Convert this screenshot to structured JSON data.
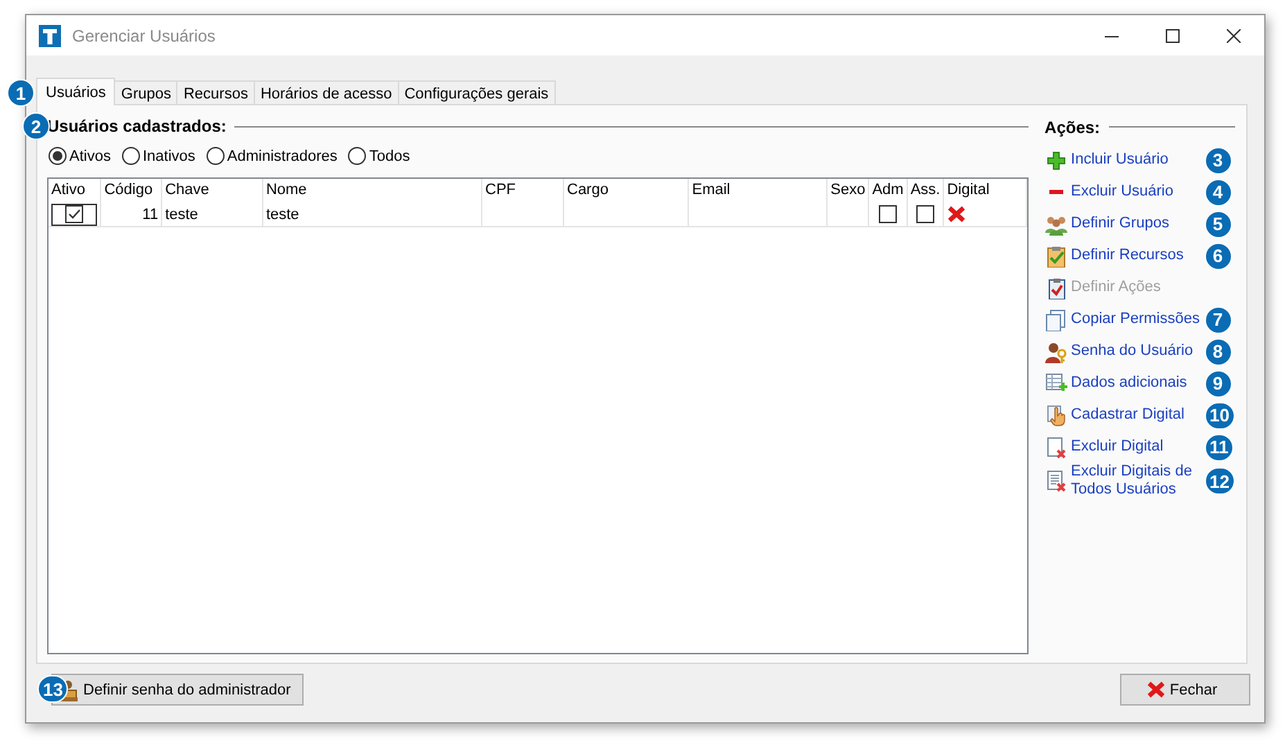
{
  "window": {
    "title": "Gerenciar Usuários"
  },
  "tabs": [
    {
      "label": "Usuários",
      "selected": true,
      "callout": "1"
    },
    {
      "label": "Grupos",
      "selected": false
    },
    {
      "label": "Recursos",
      "selected": false
    },
    {
      "label": "Horários de acesso",
      "selected": false
    },
    {
      "label": "Configurações gerais",
      "selected": false
    }
  ],
  "users_section": {
    "title": "Usuários cadastrados:",
    "callout": "2",
    "filters": [
      {
        "label": "Ativos",
        "selected": true
      },
      {
        "label": "Inativos",
        "selected": false
      },
      {
        "label": "Administradores",
        "selected": false
      },
      {
        "label": "Todos",
        "selected": false
      }
    ],
    "table": {
      "columns": [
        "Ativo",
        "Código",
        "Chave",
        "Nome",
        "CPF",
        "Cargo",
        "Email",
        "Sexo",
        "Adm",
        "Ass.",
        "Digital"
      ],
      "rows": [
        {
          "cells": [
            {
              "kind": "checkbox",
              "checked": true
            },
            {
              "kind": "number",
              "text": "11"
            },
            {
              "kind": "text",
              "text": "teste"
            },
            {
              "kind": "text",
              "text": "teste"
            },
            {
              "kind": "text"
            },
            {
              "kind": "text"
            },
            {
              "kind": "text"
            },
            {
              "kind": "text"
            },
            {
              "kind": "checkbox",
              "checked": false
            },
            {
              "kind": "checkbox",
              "checked": false
            },
            {
              "kind": "cross"
            }
          ]
        }
      ]
    }
  },
  "actions": {
    "title": "Ações:",
    "items": [
      {
        "label": "Incluir Usuário",
        "kind": "plus",
        "disabled": false,
        "callout": "3"
      },
      {
        "label": "Excluir Usuário",
        "kind": "minus",
        "disabled": false,
        "callout": "4"
      },
      {
        "label": "Definir Grupos",
        "kind": "people",
        "disabled": false,
        "callout": "5"
      },
      {
        "label": "Definir Recursos",
        "kind": "clipboard-check",
        "disabled": false,
        "callout": "6"
      },
      {
        "label": "Definir Ações",
        "kind": "clipboard",
        "disabled": true
      },
      {
        "label": "Copiar Permissões",
        "kind": "copy",
        "disabled": false,
        "callout": "7"
      },
      {
        "label": "Senha do Usuário",
        "kind": "person-key",
        "disabled": false,
        "callout": "8"
      },
      {
        "label": "Dados adicionais",
        "kind": "table-plus",
        "disabled": false,
        "callout": "9"
      },
      {
        "label": "Cadastrar Digital",
        "kind": "hand",
        "disabled": false,
        "callout": "10"
      },
      {
        "label": "Excluir Digital",
        "kind": "page-x",
        "disabled": false,
        "callout": "11"
      },
      {
        "label": "Excluir Digitais de Todos Usuários",
        "kind": "pages-x",
        "disabled": false,
        "callout": "12"
      }
    ]
  },
  "footer": {
    "admin_button": {
      "label": "Definir senha do administrador",
      "callout": "13"
    },
    "close_button": {
      "label": "Fechar"
    }
  }
}
